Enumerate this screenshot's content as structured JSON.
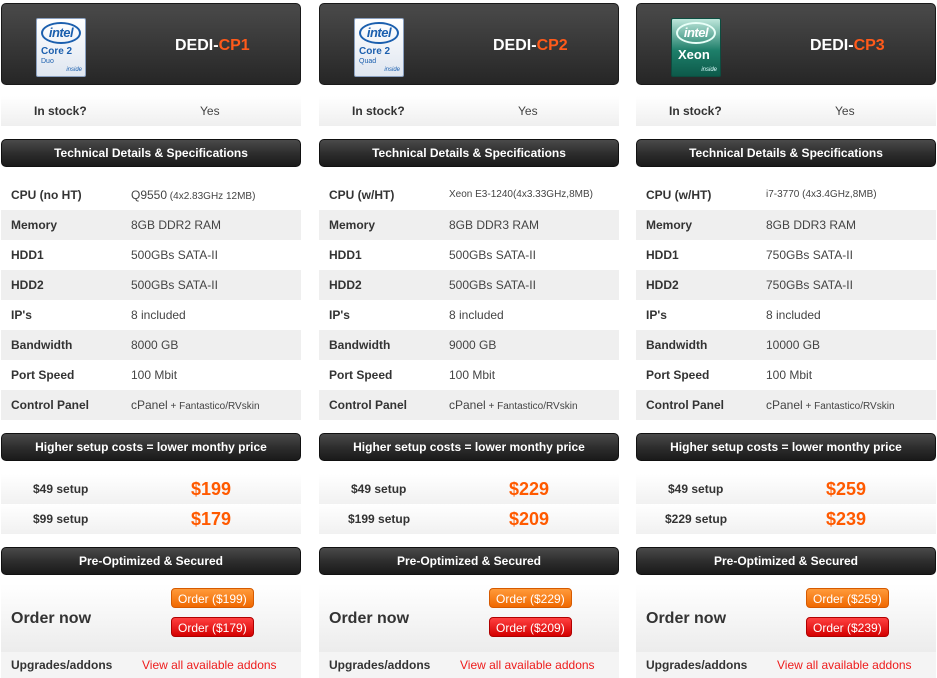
{
  "plans": [
    {
      "logo": {
        "brand": "intel",
        "family": "Core 2",
        "sub": "Duo",
        "inside": "inside"
      },
      "name_prefix": "DEDI-",
      "name_suffix": "CP1",
      "stock_label": "In stock?",
      "stock_value": "Yes",
      "tech_header": "Technical Details & Specifications",
      "specs": [
        {
          "label": "CPU (no HT)",
          "value": "Q9550",
          "detail": " (4x2.83GHz 12MB)"
        },
        {
          "label": "Memory",
          "value": "8GB DDR2 RAM",
          "detail": ""
        },
        {
          "label": "HDD1",
          "value": "500GBs SATA-II",
          "detail": ""
        },
        {
          "label": "HDD2",
          "value": "500GBs SATA-II",
          "detail": ""
        },
        {
          "label": "IP's",
          "value": "8 included",
          "detail": ""
        },
        {
          "label": "Bandwidth",
          "value": "8000 GB",
          "detail": ""
        },
        {
          "label": "Port Speed",
          "value": "100 Mbit",
          "detail": ""
        },
        {
          "label": "Control Panel",
          "value": "cPanel",
          "detail": " + Fantastico/RVskin"
        }
      ],
      "setup_header": "Higher setup costs = lower monthy price",
      "prices": [
        {
          "setup": "$49 setup",
          "price": "$199"
        },
        {
          "setup": "$99 setup",
          "price": "$179"
        }
      ],
      "secured_header": "Pre-Optimized & Secured",
      "order_label": "Order now",
      "order_buttons": [
        "Order ($199)",
        "Order ($179)"
      ],
      "addons_label": "Upgrades/addons",
      "addons_link": "View all available addons"
    },
    {
      "logo": {
        "brand": "intel",
        "family": "Core 2",
        "sub": "Quad",
        "inside": "inside"
      },
      "name_prefix": "DEDI-",
      "name_suffix": "CP2",
      "stock_label": "In stock?",
      "stock_value": "Yes",
      "tech_header": "Technical Details & Specifications",
      "specs": [
        {
          "label": "CPU (w/HT)",
          "value": "Xeon E3-1240(4x3.33GHz,8MB)",
          "detail": ""
        },
        {
          "label": "Memory",
          "value": "8GB DDR3 RAM",
          "detail": ""
        },
        {
          "label": "HDD1",
          "value": "500GBs SATA-II",
          "detail": ""
        },
        {
          "label": "HDD2",
          "value": "500GBs SATA-II",
          "detail": ""
        },
        {
          "label": "IP's",
          "value": "8 included",
          "detail": ""
        },
        {
          "label": "Bandwidth",
          "value": "9000 GB",
          "detail": ""
        },
        {
          "label": "Port Speed",
          "value": "100 Mbit",
          "detail": ""
        },
        {
          "label": "Control Panel",
          "value": "cPanel",
          "detail": " + Fantastico/RVskin"
        }
      ],
      "setup_header": "Higher setup costs = lower monthy price",
      "prices": [
        {
          "setup": "$49 setup",
          "price": "$229"
        },
        {
          "setup": "$199 setup",
          "price": "$209"
        }
      ],
      "secured_header": "Pre-Optimized & Secured",
      "order_label": "Order now",
      "order_buttons": [
        "Order ($229)",
        "Order ($209)"
      ],
      "addons_label": "Upgrades/addons",
      "addons_link": "View all available addons"
    },
    {
      "logo": {
        "brand": "intel",
        "family": "Xeon",
        "sub": "",
        "inside": "inside"
      },
      "name_prefix": "DEDI-",
      "name_suffix": "CP3",
      "stock_label": "In stock?",
      "stock_value": "Yes",
      "tech_header": "Technical Details & Specifications",
      "specs": [
        {
          "label": "CPU (w/HT)",
          "value": "i7-3770",
          "detail": " (4x3.4GHz,8MB)"
        },
        {
          "label": "Memory",
          "value": "8GB DDR3 RAM",
          "detail": ""
        },
        {
          "label": "HDD1",
          "value": "750GBs SATA-II",
          "detail": ""
        },
        {
          "label": "HDD2",
          "value": "750GBs SATA-II",
          "detail": ""
        },
        {
          "label": "IP's",
          "value": "8 included",
          "detail": ""
        },
        {
          "label": "Bandwidth",
          "value": "10000 GB",
          "detail": ""
        },
        {
          "label": "Port Speed",
          "value": "100 Mbit",
          "detail": ""
        },
        {
          "label": "Control Panel",
          "value": "cPanel",
          "detail": " + Fantastico/RVskin"
        }
      ],
      "setup_header": "Higher setup costs = lower monthy price",
      "prices": [
        {
          "setup": "$49 setup",
          "price": "$259"
        },
        {
          "setup": "$229 setup",
          "price": "$239"
        }
      ],
      "secured_header": "Pre-Optimized & Secured",
      "order_label": "Order now",
      "order_buttons": [
        "Order ($259)",
        "Order ($239)"
      ],
      "addons_label": "Upgrades/addons",
      "addons_link": "View all available addons"
    }
  ],
  "colors": {
    "accent": "#ff5a00",
    "link": "#ee1c1c",
    "order_primary": "#f57a10",
    "order_secondary": "#e00000"
  }
}
